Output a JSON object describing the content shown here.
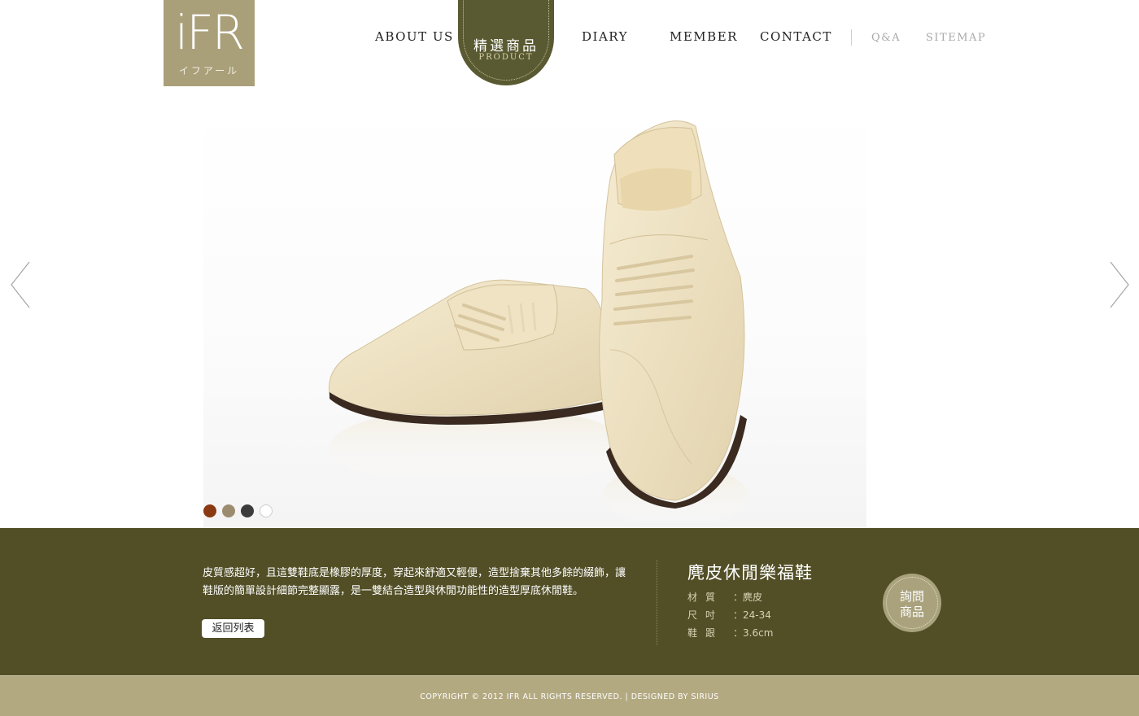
{
  "brand": {
    "logo_mark": "iFR",
    "logo_sub": "イフアール",
    "accent": "#a99f79",
    "band_color": "#524f27",
    "footer_color": "#b3a981"
  },
  "nav": {
    "about": "ABOUT US",
    "product_zh": "精選商品",
    "product_en": "PRODUCT",
    "diary": "DIARY",
    "member": "MEMBER",
    "contact": "CONTACT",
    "qa": "Q&A",
    "sitemap": "SITEMAP"
  },
  "slider": {
    "prev_icon": "chevron-left-icon",
    "next_icon": "chevron-right-icon",
    "color_swatches": [
      "#8a3a12",
      "#9c8c6f",
      "#3b3b3b",
      "#ffffff"
    ]
  },
  "product": {
    "description": "皮質感超好，且這雙鞋底是橡膠的厚度，穿起來舒適又輕便，造型捨棄其他多餘的綴飾，讓鞋版的簡單設計細節完整顯露，是一雙結合造型與休閒功能性的造型厚底休閒鞋。",
    "back_label": "返回列表",
    "title": "麂皮休閒樂福鞋",
    "specs": [
      {
        "key": "材質",
        "value": "麂皮"
      },
      {
        "key": "尺吋",
        "value": "24-34"
      },
      {
        "key": "鞋跟",
        "value": "3.6cm"
      }
    ],
    "inquiry_line1": "詢問",
    "inquiry_line2": "商品"
  },
  "footer": {
    "copyright": "COPYRIGHT © 2012 IFR  ALL RIGHTS RESERVED. | DESIGNED BY SIRIUS"
  }
}
